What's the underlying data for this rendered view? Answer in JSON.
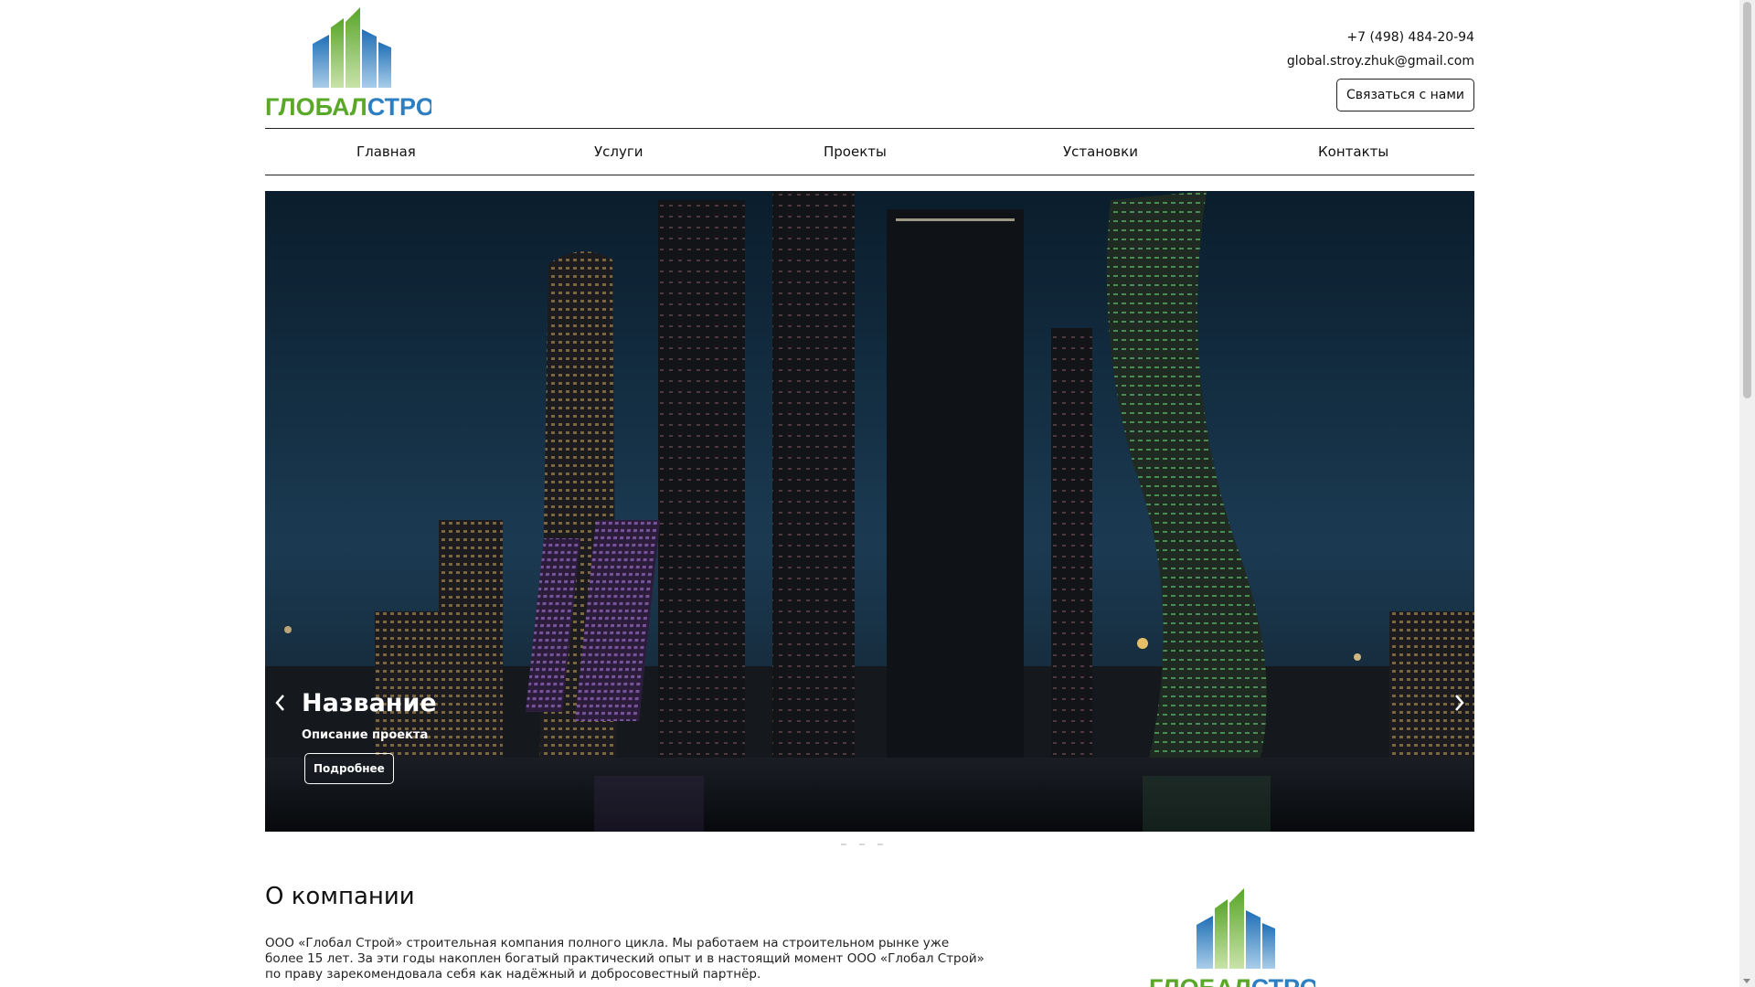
{
  "header": {
    "logo_text": "ГЛОБАЛСТРОЙ",
    "phone": "+7 (498) 484-20-94",
    "email": "global.stroy.zhuk@gmail.com",
    "contact_button": "Связаться с нами"
  },
  "nav": {
    "items": [
      {
        "label": "Главная"
      },
      {
        "label": "Услуги"
      },
      {
        "label": "Проекты"
      },
      {
        "label": "Установки"
      },
      {
        "label": "Контакты"
      }
    ]
  },
  "hero": {
    "caption_title": "Название",
    "caption_description": "Описание проекта",
    "caption_button": "Подробнее",
    "prev_icon": "chevron-left-icon",
    "next_icon": "chevron-right-icon",
    "slides_count": 3
  },
  "about": {
    "title": "О компании",
    "text": "ООО «Глобал Строй» строительная компания полного цикла. Мы работаем на строительном рынке уже более 15 лет. За эти годы накоплен богатый практический опыт и в настоящий момент ООО «Глобал Строй» по праву зарекомендовала себя как надёжный и добросовестный партнёр."
  },
  "colors": {
    "logo_blue": "#2d7fc1",
    "logo_green": "#5aa828",
    "hero_sky": "#0d2436"
  }
}
